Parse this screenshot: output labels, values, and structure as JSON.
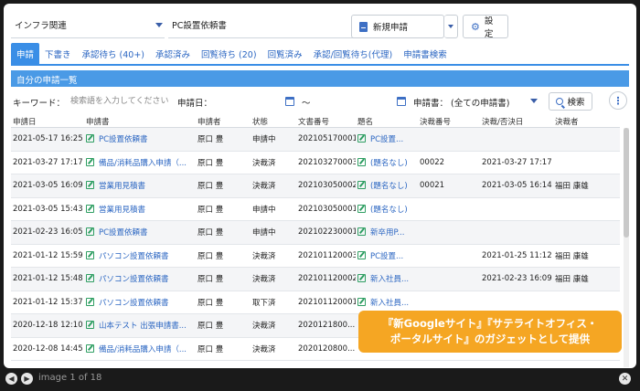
{
  "topbar": {
    "category_select": "インフラ関連",
    "form_select": "PC設置依頼書",
    "new_request_label": "新規申請",
    "settings_label": "設定"
  },
  "tabs": [
    {
      "label": "申請",
      "active": true
    },
    {
      "label": "下書き"
    },
    {
      "label": "承認待ち (40+)"
    },
    {
      "label": "承認済み"
    },
    {
      "label": "回覧待ち (20)"
    },
    {
      "label": "回覧済み"
    },
    {
      "label": "承認/回覧待ち(代理)"
    },
    {
      "label": "申請書検索"
    }
  ],
  "section_title": "自分の申請一覧",
  "search": {
    "keyword_label": "キーワード：",
    "keyword_placeholder": "検索語を入力してください",
    "date_label": "申請日：",
    "range_sep": "～",
    "form_label": "申請書：",
    "form_value": "(全ての申請書)",
    "search_button": "検索"
  },
  "table": {
    "headers": [
      "申請日",
      "申請書",
      "申請者",
      "状態",
      "文書番号",
      "題名",
      "決裁番号",
      "決裁/否決日",
      "決裁者"
    ],
    "rows": [
      [
        "2021-05-17 16:25",
        "PC設置依頼書",
        "原口 豊",
        "申請中",
        "202105170001",
        "PC設置...",
        "",
        "",
        ""
      ],
      [
        "2021-03-27 17:17",
        "備品/消耗品購入申請（...",
        "原口 豊",
        "決裁済",
        "202103270003",
        "(題名なし)",
        "00022",
        "2021-03-27 17:17",
        ""
      ],
      [
        "2021-03-05 16:09",
        "営業用見積書",
        "原口 豊",
        "決裁済",
        "202103050002",
        "(題名なし)",
        "00021",
        "2021-03-05 16:14",
        "福田 康雄"
      ],
      [
        "2021-03-05 15:43",
        "営業用見積書",
        "原口 豊",
        "申請中",
        "202103050001",
        "(題名なし)",
        "",
        "",
        ""
      ],
      [
        "2021-02-23 16:05",
        "PC設置依頼書",
        "原口 豊",
        "申請中",
        "202102230001",
        "新卒用P...",
        "",
        "",
        ""
      ],
      [
        "2021-01-12 15:59",
        "パソコン設置依頼書",
        "原口 豊",
        "決裁済",
        "202101120003",
        "PC設置...",
        "",
        "2021-01-25 11:12",
        "福田 康雄"
      ],
      [
        "2021-01-12 15:48",
        "パソコン設置依頼書",
        "原口 豊",
        "決裁済",
        "202101120002",
        "新入社員...",
        "",
        "2021-02-23 16:09",
        "福田 康雄"
      ],
      [
        "2021-01-12 15:37",
        "パソコン設置依頼書",
        "原口 豊",
        "取下済",
        "202101120001",
        "新入社員...",
        "",
        "",
        ""
      ],
      [
        "2020-12-18 12:10",
        "山本テスト 出張申請書...",
        "原口 豊",
        "決裁済",
        "2020121800...",
        "",
        "",
        "",
        ""
      ],
      [
        "2020-12-08 14:45",
        "備品/消耗品購入申請（...",
        "原口 豊",
        "決裁済",
        "2020120800...",
        "",
        "",
        "",
        ""
      ]
    ]
  },
  "promo_line1": "『新Googleサイト』『サテライトオフィス・",
  "promo_line2": "ポータルサイト』のガジェットとして提供",
  "viewer": {
    "counter": "image 1 of 18"
  }
}
